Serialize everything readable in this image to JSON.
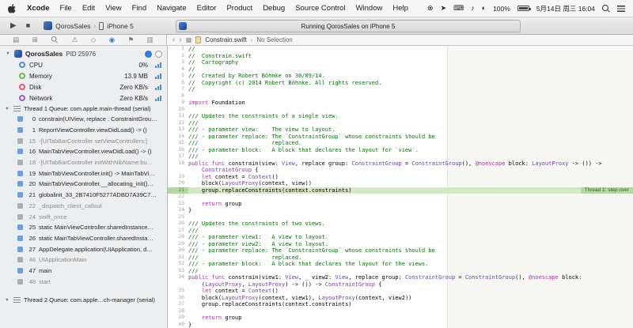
{
  "menu_bar": {
    "items": [
      "Xcode",
      "File",
      "Edit",
      "View",
      "Find",
      "Navigate",
      "Editor",
      "Product",
      "Debug",
      "Source Control",
      "Window",
      "Help"
    ],
    "status": {
      "icons": [
        {
          "name": "circle-x-status-icon",
          "glyph": "⊗"
        },
        {
          "name": "share-status-icon",
          "glyph": "➤"
        },
        {
          "name": "keyboard-status-icon",
          "glyph": "⌨"
        },
        {
          "name": "bell-status-icon",
          "glyph": "♪"
        },
        {
          "name": "display-status-icon",
          "glyph": "◐"
        }
      ],
      "battery_percent": "100%",
      "datetime": "5月14日 周三 16:04"
    }
  },
  "toolbar": {
    "scheme": {
      "name": "QorosSales",
      "device": "iPhone 5"
    },
    "activity": "Running QorosSales on iPhone 5"
  },
  "navigator": {
    "tabs": [
      {
        "name": "project-navigator",
        "glyph": "▤"
      },
      {
        "name": "symbol-navigator",
        "glyph": "⊞"
      },
      {
        "name": "find-navigator",
        "shape": "magnifier"
      },
      {
        "name": "issue-navigator",
        "glyph": "⚠"
      },
      {
        "name": "test-navigator",
        "glyph": "◇"
      },
      {
        "name": "debug-navigator",
        "glyph": "◉",
        "selected": true
      },
      {
        "name": "breakpoint-navigator",
        "glyph": "⚑"
      },
      {
        "name": "report-navigator",
        "glyph": "▥"
      }
    ],
    "process": {
      "name": "QorosSales",
      "pid": "PID 25976"
    },
    "gauges": [
      {
        "label": "CPU",
        "value": "0%",
        "color": "#4a90d9"
      },
      {
        "label": "Memory",
        "value": "13.9 MB",
        "color": "#63bb4e"
      },
      {
        "label": "Disk",
        "value": "Zero KB/s",
        "color": "#e05577"
      },
      {
        "label": "Network",
        "value": "Zero KB/s",
        "color": "#9a5bd0"
      }
    ],
    "threads": [
      {
        "label": "Thread 1 Queue: com.apple.main-thread (serial)",
        "frames": [
          {
            "num": "0",
            "text": "constrain(UIView, replace : ConstraintGrou…",
            "kind": "user"
          },
          {
            "num": "1",
            "text": "ReportViewController.viewDidLoad() -> ()",
            "kind": "user"
          },
          {
            "num": "15",
            "text": "-[UITabBarController setViewControllers:]",
            "kind": "system"
          },
          {
            "num": "16",
            "text": "MainTabViewController.viewDidLoad() -> ()",
            "kind": "user"
          },
          {
            "num": "18",
            "text": "-[UITabBarController initWithNibName:bu…",
            "kind": "system"
          },
          {
            "num": "19",
            "text": "MainTabViewController.init() -> MainTabVi…",
            "kind": "user"
          },
          {
            "num": "20",
            "text": "MainTabViewController.__allocating_init()…",
            "kind": "user"
          },
          {
            "num": "21",
            "text": "globalinit_33_2B7410F5277ADBD7A39C7…",
            "kind": "user"
          },
          {
            "num": "22",
            "text": "_dispatch_client_callout",
            "kind": "system"
          },
          {
            "num": "24",
            "text": "swift_once",
            "kind": "system"
          },
          {
            "num": "25",
            "text": "static MainViewController.sharedInstance…",
            "kind": "user"
          },
          {
            "num": "26",
            "text": "static MainTabViewController.sharedInsta…",
            "kind": "user"
          },
          {
            "num": "27",
            "text": "AppDelegate.application(UIApplication, d…",
            "kind": "user"
          },
          {
            "num": "46",
            "text": "UIApplicationMain",
            "kind": "system"
          },
          {
            "num": "47",
            "text": "main",
            "kind": "user"
          },
          {
            "num": "48",
            "text": "start",
            "kind": "system"
          }
        ]
      },
      {
        "label": "Thread 2 Queue: com.apple…ch-manager (serial)",
        "frames": []
      }
    ]
  },
  "editor": {
    "jump_bar": {
      "file": "Constrain.swift",
      "symbol": "No Selection"
    },
    "annotation": "Thread 1: step over",
    "lines": [
      {
        "n": "1",
        "tk": [
          [
            "//",
            "comment"
          ]
        ]
      },
      {
        "n": "2",
        "tk": [
          [
            "//  Constrain.swift",
            "comment"
          ]
        ]
      },
      {
        "n": "3",
        "tk": [
          [
            "//  Cartography",
            "comment"
          ]
        ]
      },
      {
        "n": "4",
        "tk": [
          [
            "//",
            "comment"
          ]
        ]
      },
      {
        "n": "5",
        "tk": [
          [
            "//  Created by Robert Böhnke on 30/09/14.",
            "comment"
          ]
        ]
      },
      {
        "n": "6",
        "tk": [
          [
            "//  Copyright (c) 2014 Robert Böhnke. All rights reserved.",
            "comment"
          ]
        ]
      },
      {
        "n": "7",
        "tk": [
          [
            "//",
            "comment"
          ]
        ]
      },
      {
        "n": "8",
        "tk": []
      },
      {
        "n": "9",
        "tk": [
          [
            "import ",
            "keyword"
          ],
          [
            "Foundation",
            "plain"
          ]
        ]
      },
      {
        "n": "10",
        "tk": []
      },
      {
        "n": "11",
        "tk": [
          [
            "/// Updates the constraints of a single view.",
            "comment"
          ]
        ]
      },
      {
        "n": "12",
        "tk": [
          [
            "///",
            "comment"
          ]
        ]
      },
      {
        "n": "13",
        "tk": [
          [
            "/// - parameter view:    The view to layout.",
            "comment"
          ]
        ]
      },
      {
        "n": "14",
        "tk": [
          [
            "/// - parameter replace: The `ConstraintGroup` whose constraints should be",
            "comment"
          ]
        ]
      },
      {
        "n": "15",
        "tk": [
          [
            "///                      replaced.",
            "comment"
          ]
        ]
      },
      {
        "n": "16",
        "tk": [
          [
            "/// - parameter block:   A block that declares the layout for `view`.",
            "comment"
          ]
        ]
      },
      {
        "n": "17",
        "tk": [
          [
            "///",
            "comment"
          ]
        ]
      },
      {
        "n": "18",
        "tk": [
          [
            "public func ",
            "keyword"
          ],
          [
            "constrain(view: ",
            "plain"
          ],
          [
            "View",
            "type"
          ],
          [
            ", replace group: ",
            "plain"
          ],
          [
            "ConstraintGroup",
            "type"
          ],
          [
            " = ",
            "plain"
          ],
          [
            "ConstraintGroup",
            "type"
          ],
          [
            "(), ",
            "plain"
          ],
          [
            "@noescape",
            "keyword"
          ],
          [
            " block: ",
            "plain"
          ],
          [
            "LayoutProxy",
            "type"
          ],
          [
            " -> ()) ->",
            "plain"
          ]
        ]
      },
      {
        "n": "",
        "tk": [
          [
            "    ",
            "plain"
          ],
          [
            "ConstraintGroup",
            "type"
          ],
          [
            " {",
            "plain"
          ]
        ]
      },
      {
        "n": "19",
        "tk": [
          [
            "    ",
            "plain"
          ],
          [
            "let",
            "keyword"
          ],
          [
            " context = ",
            "plain"
          ],
          [
            "Context",
            "type"
          ],
          [
            "()",
            "plain"
          ]
        ]
      },
      {
        "n": "20",
        "tk": [
          [
            "    block(",
            "plain"
          ],
          [
            "LayoutProxy",
            "type"
          ],
          [
            "(context, view))",
            "plain"
          ]
        ]
      },
      {
        "n": "21",
        "hl": true,
        "tk": [
          [
            "    group.replaceConstraints(context.constraints)",
            "plain"
          ]
        ]
      },
      {
        "n": "22",
        "tk": []
      },
      {
        "n": "23",
        "tk": [
          [
            "    ",
            "plain"
          ],
          [
            "return",
            "keyword"
          ],
          [
            " group",
            "plain"
          ]
        ]
      },
      {
        "n": "24",
        "tk": [
          [
            "}",
            "plain"
          ]
        ]
      },
      {
        "n": "25",
        "tk": []
      },
      {
        "n": "26",
        "tk": [
          [
            "/// Updates the constraints of two views.",
            "comment"
          ]
        ]
      },
      {
        "n": "27",
        "tk": [
          [
            "///",
            "comment"
          ]
        ]
      },
      {
        "n": "28",
        "tk": [
          [
            "/// - parameter view1:   A view to layout.",
            "comment"
          ]
        ]
      },
      {
        "n": "29",
        "tk": [
          [
            "/// - parameter view2:   A view to layout.",
            "comment"
          ]
        ]
      },
      {
        "n": "30",
        "tk": [
          [
            "/// - parameter replace: The `ConstraintGroup` whose constraints should be",
            "comment"
          ]
        ]
      },
      {
        "n": "31",
        "tk": [
          [
            "///                      replaced.",
            "comment"
          ]
        ]
      },
      {
        "n": "32",
        "tk": [
          [
            "/// - parameter block:   A block that declares the layout for the views.",
            "comment"
          ]
        ]
      },
      {
        "n": "33",
        "tk": [
          [
            "///",
            "comment"
          ]
        ]
      },
      {
        "n": "34",
        "tk": [
          [
            "public func ",
            "keyword"
          ],
          [
            "constrain(view1: ",
            "plain"
          ],
          [
            "View",
            "type"
          ],
          [
            ", _ view2: ",
            "plain"
          ],
          [
            "View",
            "type"
          ],
          [
            ", replace group: ",
            "plain"
          ],
          [
            "ConstraintGroup",
            "type"
          ],
          [
            " = ",
            "plain"
          ],
          [
            "ConstraintGroup",
            "type"
          ],
          [
            "(), ",
            "plain"
          ],
          [
            "@noescape",
            "keyword"
          ],
          [
            " block:",
            "plain"
          ]
        ]
      },
      {
        "n": "",
        "tk": [
          [
            "    (",
            "plain"
          ],
          [
            "LayoutProxy",
            "type"
          ],
          [
            ", ",
            "plain"
          ],
          [
            "LayoutProxy",
            "type"
          ],
          [
            ") -> ()) -> ",
            "plain"
          ],
          [
            "ConstraintGroup",
            "type"
          ],
          [
            " {",
            "plain"
          ]
        ]
      },
      {
        "n": "35",
        "tk": [
          [
            "    ",
            "plain"
          ],
          [
            "let",
            "keyword"
          ],
          [
            " context = ",
            "plain"
          ],
          [
            "Context",
            "type"
          ],
          [
            "()",
            "plain"
          ]
        ]
      },
      {
        "n": "36",
        "tk": [
          [
            "    block(",
            "plain"
          ],
          [
            "LayoutProxy",
            "type"
          ],
          [
            "(context, view1), ",
            "plain"
          ],
          [
            "LayoutProxy",
            "type"
          ],
          [
            "(context, view2))",
            "plain"
          ]
        ]
      },
      {
        "n": "37",
        "tk": [
          [
            "    group.replaceConstraints(context.constraints)",
            "plain"
          ]
        ]
      },
      {
        "n": "38",
        "tk": []
      },
      {
        "n": "39",
        "tk": [
          [
            "    ",
            "plain"
          ],
          [
            "return",
            "keyword"
          ],
          [
            " group",
            "plain"
          ]
        ]
      },
      {
        "n": "40",
        "tk": [
          [
            "}",
            "plain"
          ]
        ]
      }
    ]
  },
  "colors": {
    "accent_blue": "#2a7fd4",
    "run_line_bg": "#d3e8c3",
    "run_line_gutter_bg": "#b5d7a0",
    "badge_bg": "#b5d7a0",
    "badge_text": "#3a6124",
    "syntax": {
      "comment": "#007400",
      "keyword": "#bb2ca2",
      "type": "#703daa",
      "plain": "#000000"
    }
  }
}
